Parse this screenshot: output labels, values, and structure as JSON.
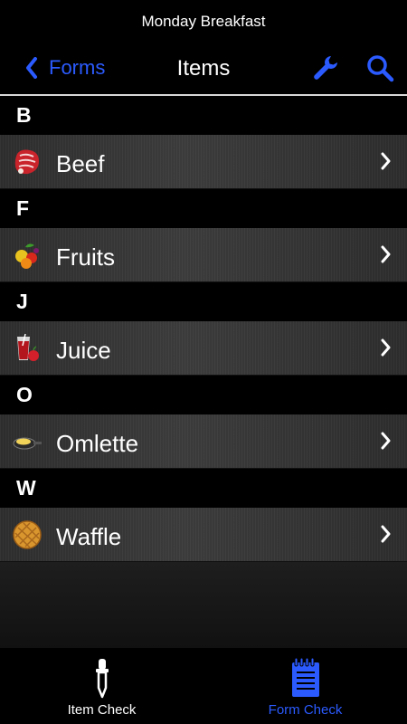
{
  "status_bar": {
    "title": "Monday Breakfast"
  },
  "navbar": {
    "back_label": "Forms",
    "title": "Items",
    "accent_color": "#2b5bff",
    "icons": [
      "chevron-left-icon",
      "wrench-icon",
      "search-icon"
    ]
  },
  "list": {
    "sections": [
      {
        "letter": "B",
        "item": {
          "label": "Beef",
          "icon": "beef-icon"
        }
      },
      {
        "letter": "F",
        "item": {
          "label": "Fruits",
          "icon": "fruits-icon"
        }
      },
      {
        "letter": "J",
        "item": {
          "label": "Juice",
          "icon": "juice-icon"
        }
      },
      {
        "letter": "O",
        "item": {
          "label": "Omlette",
          "icon": "omelette-icon"
        }
      },
      {
        "letter": "W",
        "item": {
          "label": "Waffle",
          "icon": "waffle-icon"
        }
      }
    ]
  },
  "tabbar": {
    "tabs": [
      {
        "label": "Item Check",
        "icon": "dropper-icon",
        "selected": false,
        "color": "#ffffff"
      },
      {
        "label": "Form Check",
        "icon": "notepad-icon",
        "selected": true,
        "color": "#2b5bff"
      }
    ]
  }
}
